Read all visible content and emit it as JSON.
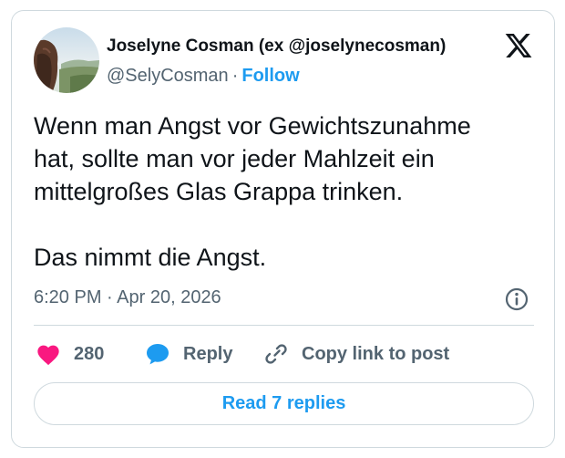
{
  "author": {
    "display_name": "Joselyne Cosman (ex @joselynecosman)",
    "handle": "@SelyCosman",
    "separator": "·",
    "follow_label": "Follow"
  },
  "tweet": {
    "lines": [
      "Wenn man Angst vor Gewichtszunahme",
      "hat, sollte man vor jeder Mahlzeit ein",
      "mittelgroßes Glas Grappa trinken.",
      "Das nimmt die Angst."
    ],
    "timestamp": "6:20 PM · Apr 20, 2026"
  },
  "actions": {
    "like_count": "280",
    "reply_label": "Reply",
    "copy_link_label": "Copy link to post"
  },
  "read_replies_label": "Read 7 replies",
  "colors": {
    "accent": "#1d9bf0",
    "like": "#f91880",
    "text": "#0f1419",
    "muted": "#536471",
    "border": "#cfd9de"
  },
  "icons": {
    "logo": "x-logo-icon",
    "info": "info-icon",
    "like": "heart-icon",
    "reply": "speech-bubble-icon",
    "copy_link": "link-icon"
  }
}
